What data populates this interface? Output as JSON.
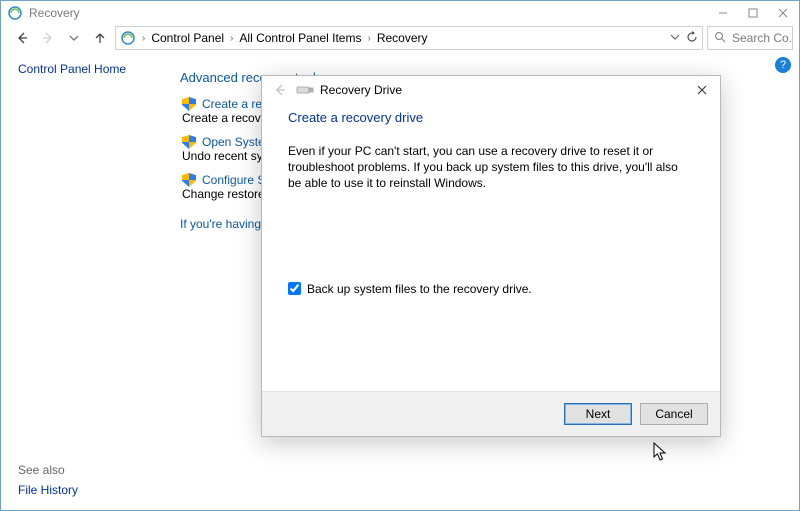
{
  "window": {
    "title": "Recovery"
  },
  "nav": {
    "breadcrumb": [
      "Control Panel",
      "All Control Panel Items",
      "Recovery"
    ],
    "search_placeholder": "Search Co..."
  },
  "sidebar": {
    "home_link": "Control Panel Home",
    "see_also_heading": "See also",
    "see_also_link": "File History"
  },
  "main": {
    "heading": "Advanced recovery tools",
    "tools": [
      {
        "title": "Create a recovery drive",
        "desc": "Create a recovery drive to troubleshoot problems when your PC can't start."
      },
      {
        "title": "Open System Restore",
        "desc": "Undo recent system changes, but leave files such as documents, pictures, and music unchanged."
      },
      {
        "title": "Configure System Restore",
        "desc": "Change restore settings, manage disk space, and create or delete restore points."
      }
    ],
    "trouble_link": "If you're having problems with your PC, go to Settings and try resetting it"
  },
  "help": {
    "label": "?"
  },
  "dialog": {
    "wizard_name": "Recovery Drive",
    "heading": "Create a recovery drive",
    "body_text": "Even if your PC can't start, you can use a recovery drive to reset it or troubleshoot problems. If you back up system files to this drive, you'll also be able to use it to reinstall Windows.",
    "checkbox_label": "Back up system files to the recovery drive.",
    "checkbox_checked": true,
    "next_label": "Next",
    "cancel_label": "Cancel"
  }
}
